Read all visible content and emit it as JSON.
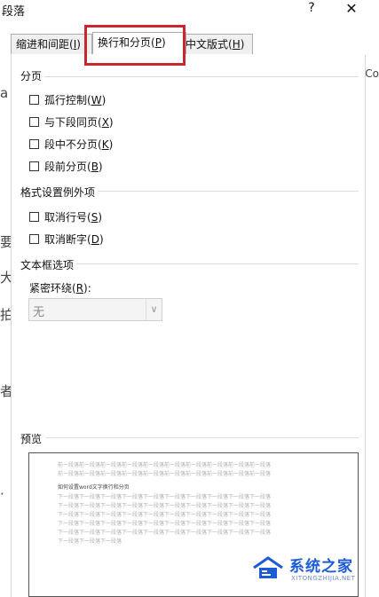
{
  "background": {
    "left_chars": [
      "a",
      "要",
      "大",
      "拍",
      "者",
      "·"
    ],
    "right_char": "Co"
  },
  "dialog": {
    "title": "段落",
    "help_glyph": "?",
    "close_glyph": "✕"
  },
  "tabs": [
    {
      "label": "缩进和间距(",
      "mnemonic": "I",
      "suffix": ")"
    },
    {
      "label": "换行和分页(",
      "mnemonic": "P",
      "suffix": ")"
    },
    {
      "label": "中文版式(",
      "mnemonic": "H",
      "suffix": ")"
    }
  ],
  "pagination": {
    "title": "分页",
    "options": [
      {
        "label": "孤行控制(",
        "mnemonic": "W",
        "suffix": ")",
        "checked": false
      },
      {
        "label": "与下段同页(",
        "mnemonic": "X",
        "suffix": ")",
        "checked": false
      },
      {
        "label": "段中不分页(",
        "mnemonic": "K",
        "suffix": ")",
        "checked": false
      },
      {
        "label": "段前分页(",
        "mnemonic": "B",
        "suffix": ")",
        "checked": false
      }
    ]
  },
  "exceptions": {
    "title": "格式设置例外项",
    "options": [
      {
        "label": "取消行号(",
        "mnemonic": "S",
        "suffix": ")",
        "checked": false
      },
      {
        "label": "取消断字(",
        "mnemonic": "D",
        "suffix": ")",
        "checked": false
      }
    ]
  },
  "textbox": {
    "title": "文本框选项",
    "tight_wrap_label": "紧密环绕(",
    "tight_wrap_mnemonic": "R",
    "tight_wrap_suffix": "):",
    "tight_wrap_value": "无",
    "dropdown_glyph": "∨"
  },
  "preview": {
    "title": "预览",
    "lines": [
      {
        "text": "前一段落前一段落前一段落前一段落前一段落前一段落前一段落前一段落前一段落前一段落",
        "dark": false
      },
      {
        "text": "前一段落前一段落前一段落前一段落前一段落前一段落前一段落前一段落前一段落前一段落",
        "dark": false
      },
      {
        "text": "如何设置word文字换行和分页",
        "dark": true
      },
      {
        "text": "下一段落下一段落下一段落下一段落下一段落下一段落下一段落下一段落下一段落下一段落",
        "dark": false
      },
      {
        "text": "下一段落下一段落下一段落下一段落下一段落下一段落下一段落下一段落下一段落下一段落",
        "dark": false
      },
      {
        "text": "下一段落下一段落下一段落下一段落下一段落下一段落下一段落下一段落下一段落下一段落",
        "dark": false
      },
      {
        "text": "下一段落下一段落下一段落下一段落下一段落下一段落下一段落下一段落下一段落下一段落",
        "dark": false
      },
      {
        "text": "下一段落下一段落下一段落下一段落下一段落下一段落下一段落下一段落下一段落下一段落",
        "dark": false
      },
      {
        "text": "下一段落下一段落下一段落",
        "dark": false
      }
    ]
  },
  "watermark": {
    "name": "系统之家",
    "url": "XITONGZHIJIA.NET"
  },
  "colors": {
    "highlight": "#c8282e",
    "watermark": "#1d5bd6"
  }
}
